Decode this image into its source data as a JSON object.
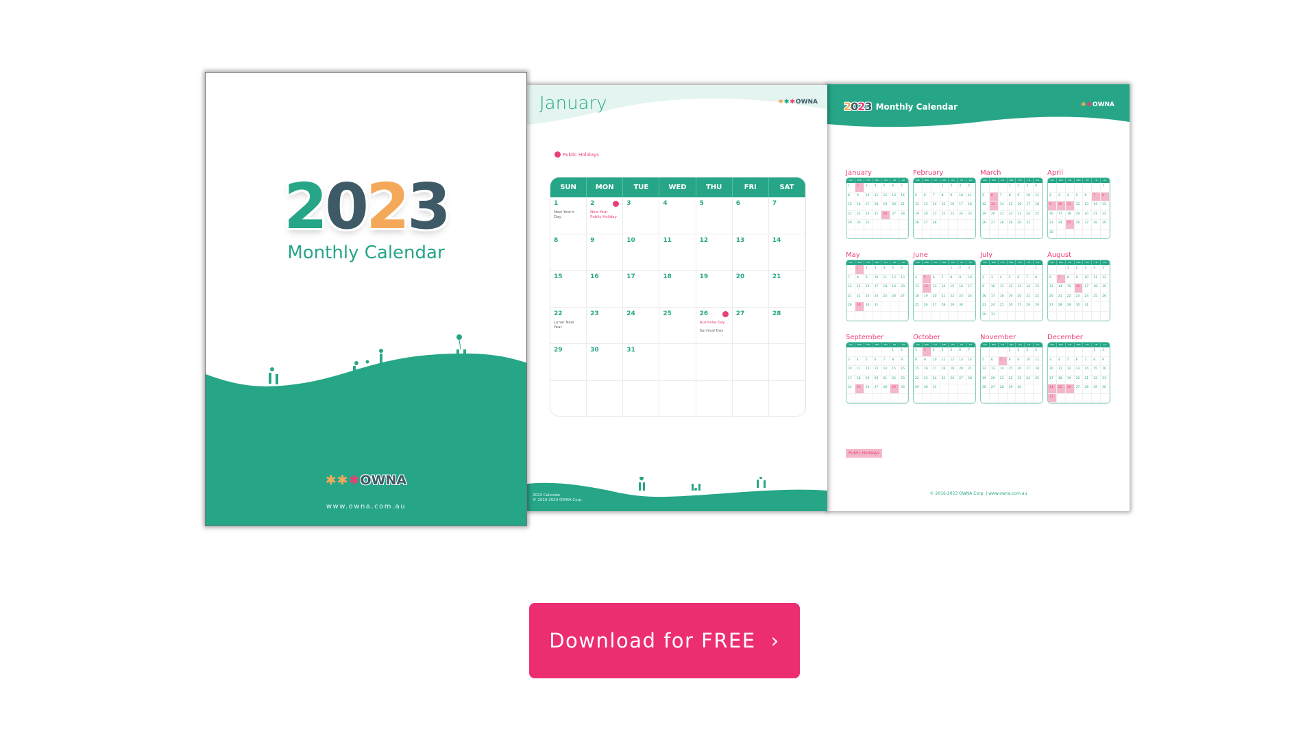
{
  "colors": {
    "teal": "#26a687",
    "pink": "#e93f73",
    "orange": "#f4a95a",
    "slate": "#3d5a66",
    "button": "#ec2d72",
    "holiday_fill": "#f4b7c9"
  },
  "cover": {
    "year_digits": [
      "2",
      "0",
      "2",
      "3"
    ],
    "subtitle": "Monthly Calendar",
    "brand": "OWNA",
    "url": "www.owna.com.au"
  },
  "month_page": {
    "title": "January",
    "brand": "OWNA",
    "legend_label": "Public Holidays",
    "weekdays": [
      "SUN",
      "MON",
      "TUE",
      "WED",
      "THU",
      "FRI",
      "SAT"
    ],
    "days": [
      {
        "num": "1",
        "events": [
          {
            "text": "New Year's Day",
            "holiday": false
          }
        ]
      },
      {
        "num": "2",
        "holiday_dot": true,
        "events": [
          {
            "text": "New Year Public Holiday",
            "holiday": true
          }
        ]
      },
      {
        "num": "3"
      },
      {
        "num": "4"
      },
      {
        "num": "5"
      },
      {
        "num": "6"
      },
      {
        "num": "7"
      },
      {
        "num": "8"
      },
      {
        "num": "9"
      },
      {
        "num": "10"
      },
      {
        "num": "11"
      },
      {
        "num": "12"
      },
      {
        "num": "13"
      },
      {
        "num": "14"
      },
      {
        "num": "15"
      },
      {
        "num": "16"
      },
      {
        "num": "17"
      },
      {
        "num": "18"
      },
      {
        "num": "19"
      },
      {
        "num": "20"
      },
      {
        "num": "21"
      },
      {
        "num": "22",
        "events": [
          {
            "text": "Lunar New Year",
            "holiday": false
          }
        ]
      },
      {
        "num": "23"
      },
      {
        "num": "24"
      },
      {
        "num": "25"
      },
      {
        "num": "26",
        "holiday_dot": true,
        "events": [
          {
            "text": "Australia Day",
            "holiday": true
          },
          {
            "text": "Survival Day",
            "holiday": false
          }
        ]
      },
      {
        "num": "27"
      },
      {
        "num": "28"
      },
      {
        "num": "29"
      },
      {
        "num": "30"
      },
      {
        "num": "31"
      },
      {
        "num": ""
      },
      {
        "num": ""
      },
      {
        "num": ""
      },
      {
        "num": ""
      },
      {
        "num": ""
      },
      {
        "num": ""
      },
      {
        "num": ""
      },
      {
        "num": ""
      },
      {
        "num": ""
      },
      {
        "num": ""
      },
      {
        "num": ""
      }
    ],
    "footer_line1": "2023 Calendar",
    "footer_line2": "© 2016-2023 OWNA Corp."
  },
  "year_page": {
    "year_digits": [
      "2",
      "0",
      "2",
      "3"
    ],
    "title": "Monthly Calendar",
    "brand": "OWNA",
    "weekdays": [
      "SUN",
      "MON",
      "TUE",
      "WED",
      "THU",
      "FRI",
      "SAT"
    ],
    "months": [
      {
        "name": "January",
        "start": 0,
        "days": 31,
        "holidays": [
          2,
          26
        ]
      },
      {
        "name": "February",
        "start": 3,
        "days": 28,
        "holidays": []
      },
      {
        "name": "March",
        "start": 3,
        "days": 31,
        "holidays": [
          6,
          13
        ]
      },
      {
        "name": "April",
        "start": 6,
        "days": 30,
        "holidays": [
          7,
          8,
          9,
          10,
          11,
          25
        ]
      },
      {
        "name": "May",
        "start": 1,
        "days": 31,
        "holidays": [
          1,
          29
        ]
      },
      {
        "name": "June",
        "start": 4,
        "days": 30,
        "holidays": [
          5,
          12
        ]
      },
      {
        "name": "July",
        "start": 6,
        "days": 31,
        "holidays": []
      },
      {
        "name": "August",
        "start": 2,
        "days": 31,
        "holidays": [
          7,
          16
        ]
      },
      {
        "name": "September",
        "start": 5,
        "days": 30,
        "holidays": [
          25,
          29
        ]
      },
      {
        "name": "October",
        "start": 0,
        "days": 31,
        "holidays": [
          2
        ]
      },
      {
        "name": "November",
        "start": 3,
        "days": 30,
        "holidays": [
          7
        ]
      },
      {
        "name": "December",
        "start": 5,
        "days": 31,
        "holidays": [
          24,
          25,
          26,
          31
        ]
      }
    ],
    "legend_label": "Public Holidays",
    "copyright": "© 2016-2023 OWNA Corp. | www.owna.com.au"
  },
  "cta": {
    "label": "Download for FREE",
    "icon": "chevron-right-icon",
    "glyph": "›"
  }
}
